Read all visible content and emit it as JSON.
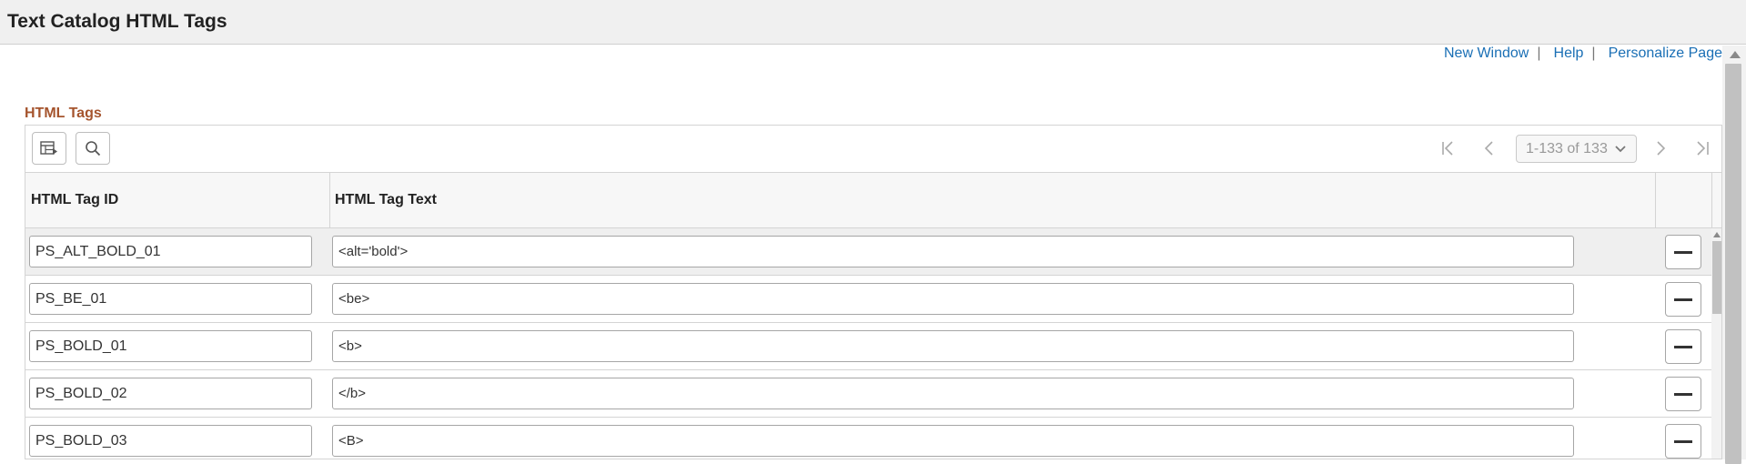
{
  "page": {
    "title": "Text Catalog HTML Tags"
  },
  "toplinks": [
    {
      "label": "New Window"
    },
    {
      "label": "Help"
    },
    {
      "label": "Personalize Page"
    }
  ],
  "separator": "|",
  "section": {
    "title": "HTML Tags"
  },
  "grid": {
    "pager_text": "1-133 of 133",
    "columns": {
      "id": "HTML Tag ID",
      "text": "HTML Tag Text"
    },
    "rows": [
      {
        "id": "PS_ALT_BOLD_01",
        "text": "<alt='bold'>"
      },
      {
        "id": "PS_BE_01",
        "text": "<be>"
      },
      {
        "id": "PS_BOLD_01",
        "text": "<b>"
      },
      {
        "id": "PS_BOLD_02",
        "text": "</b>"
      },
      {
        "id": "PS_BOLD_03",
        "text": "<B>"
      }
    ]
  },
  "colors": {
    "link": "#1a6fb5",
    "section_title": "#a5542d"
  }
}
